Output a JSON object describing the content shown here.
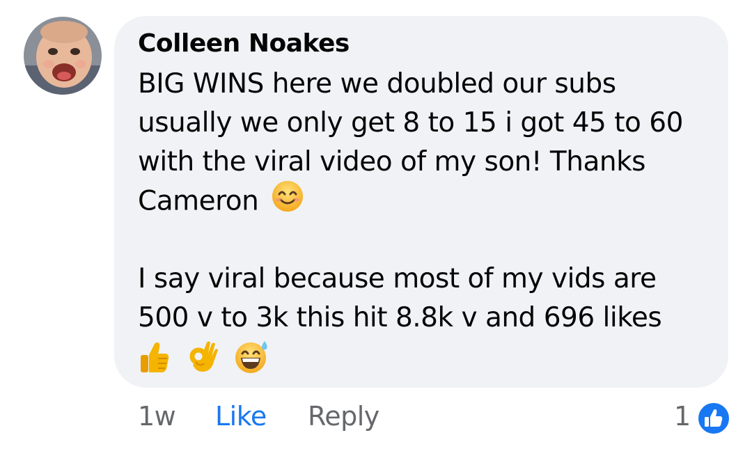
{
  "comment": {
    "author": "Colleen Noakes",
    "lines": [
      "BIG WINS here we doubled our subs",
      "usually we only get 8 to 15 i got 45 to 60",
      "with the viral video of my son! Thanks",
      "Cameron",
      "I say viral because most of my vids are",
      "500 v to 3k this hit 8.8k v and 696 likes"
    ],
    "inline_emoji": "smiling-face-icon",
    "trailing_emojis": [
      "thumbs-up-icon",
      "ok-hand-icon",
      "grinning-sweat-icon"
    ]
  },
  "footer": {
    "time": "1w",
    "like_label": "Like",
    "reply_label": "Reply",
    "reaction_count": "1",
    "reaction_icon": "like-reaction-icon"
  },
  "colors": {
    "bubble": "#f0f2f5",
    "link_blue": "#1877f2",
    "meta_gray": "#65676b",
    "text": "#050505"
  }
}
